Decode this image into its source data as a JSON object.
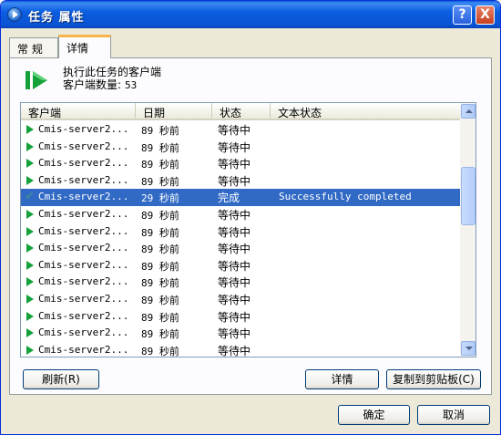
{
  "window": {
    "title": "任务 属性"
  },
  "title_buttons": {
    "help": "?",
    "close": "X"
  },
  "tabs": [
    {
      "label": "常 规"
    },
    {
      "label": "详情"
    }
  ],
  "info": {
    "line1": "执行此任务的客户端",
    "count_label": "客户端数量:",
    "count_value": "53"
  },
  "columns": {
    "client": "客户端",
    "date": "日期",
    "status": "状态",
    "text_status": "文本状态"
  },
  "rows": [
    {
      "client": "Cmis-server2...",
      "date": "89 秒前",
      "status": "等待中",
      "text": "",
      "icon": "play-icon"
    },
    {
      "client": "Cmis-server2...",
      "date": "89 秒前",
      "status": "等待中",
      "text": "",
      "icon": "play-icon"
    },
    {
      "client": "Cmis-server2...",
      "date": "89 秒前",
      "status": "等待中",
      "text": "",
      "icon": "play-icon"
    },
    {
      "client": "Cmis-server2...",
      "date": "89 秒前",
      "status": "等待中",
      "text": "",
      "icon": "play-icon"
    },
    {
      "client": "Cmis-server2...",
      "date": "29 秒前",
      "status": "完成",
      "text": "Successfully completed",
      "icon": "check-icon",
      "selected": true
    },
    {
      "client": "Cmis-server2...",
      "date": "89 秒前",
      "status": "等待中",
      "text": "",
      "icon": "play-icon"
    },
    {
      "client": "Cmis-server2...",
      "date": "89 秒前",
      "status": "等待中",
      "text": "",
      "icon": "play-icon"
    },
    {
      "client": "Cmis-server2...",
      "date": "89 秒前",
      "status": "等待中",
      "text": "",
      "icon": "play-icon"
    },
    {
      "client": "Cmis-server2...",
      "date": "89 秒前",
      "status": "等待中",
      "text": "",
      "icon": "play-icon"
    },
    {
      "client": "Cmis-server2...",
      "date": "89 秒前",
      "status": "等待中",
      "text": "",
      "icon": "play-icon"
    },
    {
      "client": "Cmis-server2...",
      "date": "89 秒前",
      "status": "等待中",
      "text": "",
      "icon": "play-icon"
    },
    {
      "client": "Cmis-server2...",
      "date": "89 秒前",
      "status": "等待中",
      "text": "",
      "icon": "play-icon"
    },
    {
      "client": "Cmis-server2...",
      "date": "89 秒前",
      "status": "等待中",
      "text": "",
      "icon": "play-icon"
    },
    {
      "client": "Cmis-server2...",
      "date": "89 秒前",
      "status": "等待中",
      "text": "",
      "icon": "play-icon"
    }
  ],
  "buttons": {
    "refresh": "刷新(R)",
    "details": "详情",
    "copy": "复制到剪贴板(C)",
    "ok": "确定",
    "cancel": "取消"
  },
  "colors": {
    "selection": "#316ac5",
    "titlebar": "#0a5fd8",
    "run_icon": "#14a13a"
  }
}
